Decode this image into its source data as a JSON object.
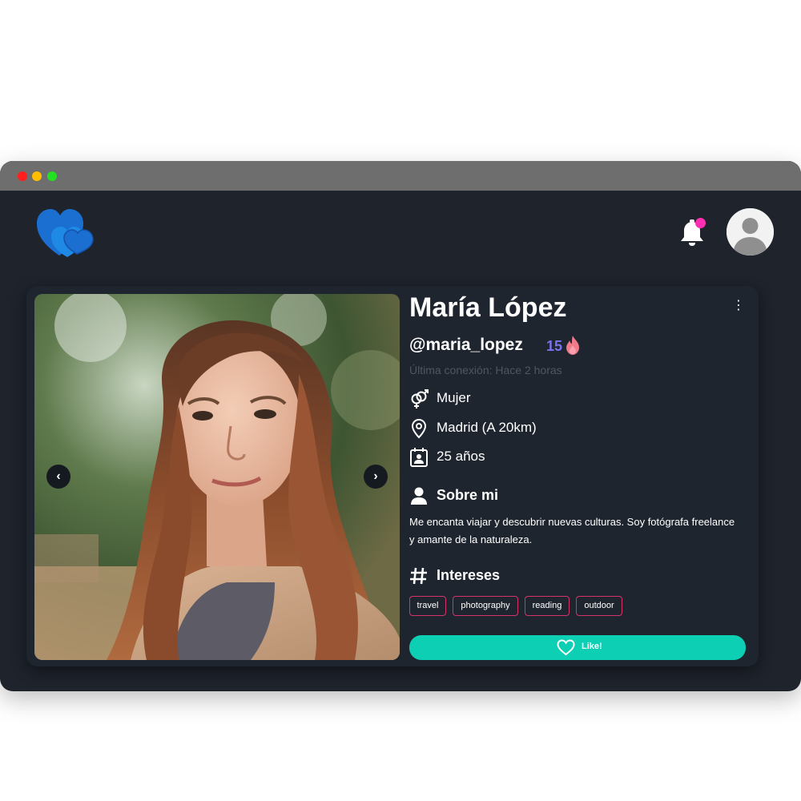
{
  "header": {
    "logo_icon": "hearts-logo-icon",
    "notification_icon": "bell-icon",
    "notification_badge_color": "#ff2fb3",
    "avatar_icon": "user-avatar-icon"
  },
  "profile": {
    "name": "María López",
    "username": "@maria_lopez",
    "score": "15",
    "score_icon": "flame-icon",
    "last_seen": "Última conexión: Hace 2 horas",
    "gender": "Mujer",
    "location": "Madrid (A 20km)",
    "age": "25 años",
    "photo_prev": "‹",
    "photo_next": "›",
    "more_menu": "⋮"
  },
  "about": {
    "title": "Sobre mi",
    "text": "Me encanta viajar y descubrir nuevas culturas. Soy fotógrafa freelance y amante de la naturaleza."
  },
  "interests": {
    "title": "Intereses",
    "tags": [
      "travel",
      "photography",
      "reading",
      "outdoor"
    ]
  },
  "actions": {
    "like_label": "Like!"
  },
  "colors": {
    "background": "#1e232c",
    "card": "#1f252f",
    "accent": "#0dcfb4",
    "tag_border": "#d6336c",
    "score": "#7a73f0",
    "brand": "#1876d6"
  }
}
